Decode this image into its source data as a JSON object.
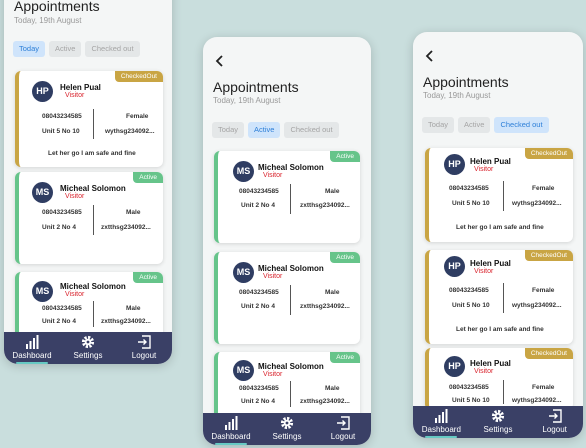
{
  "page": {
    "title": "Appointments",
    "date": "Today, 19th August"
  },
  "tabs": {
    "today": "Today",
    "active": "Active",
    "checked_out": "Checked out"
  },
  "nav": {
    "dashboard": "Dashboard",
    "settings": "Settings",
    "logout": "Logout"
  },
  "colors": {
    "navbar": "#3a4066",
    "checked_out": "#c9a544",
    "active": "#66c48a",
    "visitor_role": "#d9232d",
    "tab_selected": "#2f80d8"
  },
  "screens": [
    {
      "selected_tab": "today",
      "has_back": false,
      "cards": [
        {
          "initials": "HP",
          "name": "Helen Pual",
          "role": "Visitor",
          "status": "CheckedOut",
          "phone": "08043234585",
          "gender": "Female",
          "unit": "Unit 5 No 10",
          "code": "wythsg234092...",
          "note": "Let her go I am safe and fine"
        },
        {
          "initials": "MS",
          "name": "Micheal Solomon",
          "role": "Visitor",
          "status": "Active",
          "phone": "08043234585",
          "gender": "Male",
          "unit": "Unit 2 No 4",
          "code": "zxtthsg234092...",
          "note": ""
        },
        {
          "initials": "MS",
          "name": "Micheal Solomon",
          "role": "Visitor",
          "status": "Active",
          "phone": "08043234585",
          "gender": "Male",
          "unit": "Unit 2 No 4",
          "code": "zxtthsg234092...",
          "note": ""
        }
      ]
    },
    {
      "selected_tab": "active",
      "has_back": true,
      "cards": [
        {
          "initials": "MS",
          "name": "Micheal Solomon",
          "role": "Visitor",
          "status": "Active",
          "phone": "08043234585",
          "gender": "Male",
          "unit": "Unit 2 No 4",
          "code": "zxtthsg234092...",
          "note": ""
        },
        {
          "initials": "MS",
          "name": "Micheal Solomon",
          "role": "Visitor",
          "status": "Active",
          "phone": "08043234585",
          "gender": "Male",
          "unit": "Unit 2 No 4",
          "code": "zxtthsg234092...",
          "note": ""
        },
        {
          "initials": "MS",
          "name": "Micheal Solomon",
          "role": "Visitor",
          "status": "Active",
          "phone": "08043234585",
          "gender": "Male",
          "unit": "Unit 2 No 4",
          "code": "zxtthsg234092...",
          "note": ""
        }
      ]
    },
    {
      "selected_tab": "checked_out",
      "has_back": true,
      "cards": [
        {
          "initials": "HP",
          "name": "Helen Pual",
          "role": "Visitor",
          "status": "CheckedOut",
          "phone": "08043234585",
          "gender": "Female",
          "unit": "Unit 5 No 10",
          "code": "wythsg234092...",
          "note": "Let her go I am safe and fine"
        },
        {
          "initials": "HP",
          "name": "Helen Pual",
          "role": "Visitor",
          "status": "CheckedOut",
          "phone": "08043234585",
          "gender": "Female",
          "unit": "Unit 5 No 10",
          "code": "wythsg234092...",
          "note": "Let her go I am safe and fine"
        },
        {
          "initials": "HP",
          "name": "Helen Pual",
          "role": "Visitor",
          "status": "CheckedOut",
          "phone": "08043234585",
          "gender": "Female",
          "unit": "Unit 5 No 10",
          "code": "wythsg234092...",
          "note": ""
        }
      ]
    }
  ]
}
